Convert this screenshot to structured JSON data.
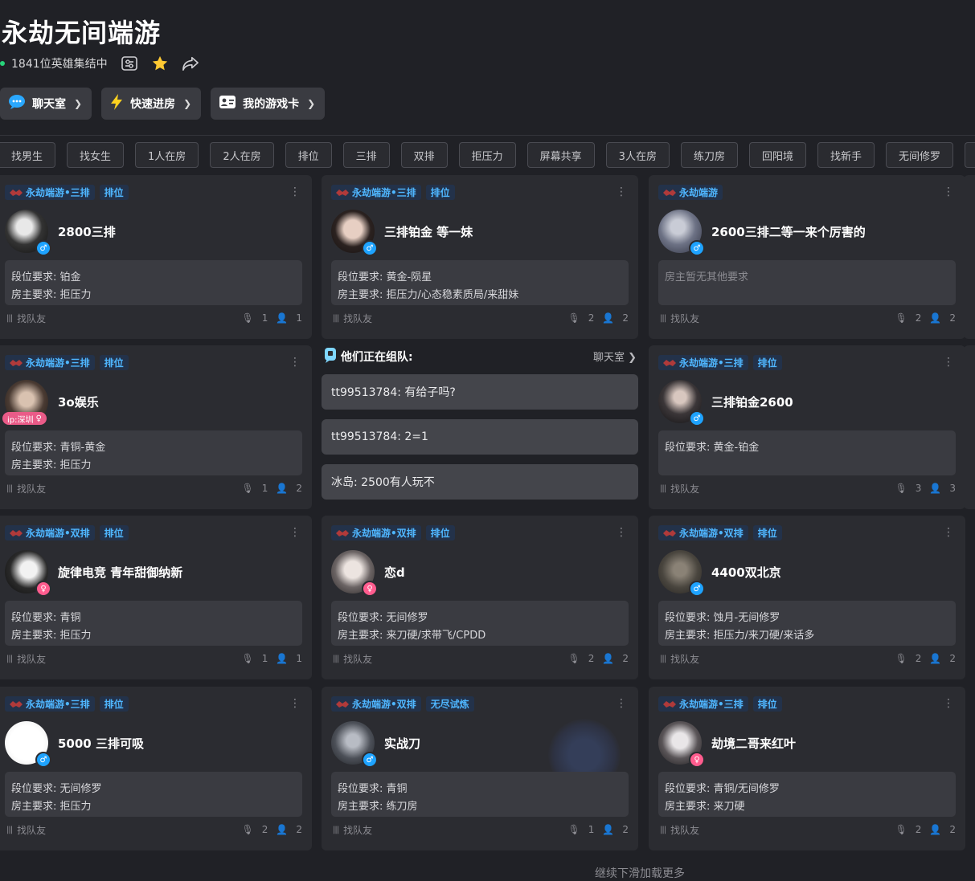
{
  "header": {
    "title": "永劫无间端游",
    "online_text": "1841位英雄集结中"
  },
  "buttons": [
    {
      "label": "聊天室",
      "icon": "chat-bubble-icon"
    },
    {
      "label": "快速进房",
      "icon": "lightning-icon"
    },
    {
      "label": "我的游戏卡",
      "icon": "id-card-icon"
    }
  ],
  "filters": [
    "找男生",
    "找女生",
    "1人在房",
    "2人在房",
    "排位",
    "三排",
    "双排",
    "拒压力",
    "屏幕共享",
    "3人在房",
    "练刀房",
    "回阳境",
    "找新手",
    "无间修罗"
  ],
  "colors": {
    "accent": "#4fb6ff",
    "male": "#1ea3ff",
    "female": "#ff5c8e",
    "online": "#27d47a"
  },
  "rooms": [
    {
      "game": "永劫端游•三排",
      "mode": "排位",
      "title": "2800三排",
      "gender": "male",
      "rank": "段位要求: 铂金",
      "owner": "房主要求: 拒压力",
      "footer": "找队友",
      "mic": "1",
      "people": "1"
    },
    {
      "game": "永劫端游•三排",
      "mode": "排位",
      "title": "三排铂金 等一妹",
      "gender": "male",
      "rank": "段位要求: 黄金-陨星",
      "owner": "房主要求: 拒压力/心态稳素质局/来甜妹",
      "footer": "找队友",
      "mic": "2",
      "people": "2"
    },
    {
      "game": "永劫端游",
      "mode": "",
      "title": "2600三排二等一来个厉害的",
      "gender": "male",
      "rank": "房主暂无其他要求",
      "owner": "",
      "footer": "找队友",
      "mic": "2",
      "people": "2"
    },
    {
      "game": "永劫端游•三排",
      "mode": "排位",
      "title": "3o娱乐",
      "gender": "female",
      "ip": "ip:深圳",
      "rank": "段位要求: 青铜-黄金",
      "owner": "房主要求: 拒压力",
      "footer": "找队友",
      "mic": "1",
      "people": "2"
    },
    {
      "game": "永劫端游•三排",
      "mode": "排位",
      "title": "三排铂金2600",
      "gender": "male",
      "rank": "段位要求: 黄金-铂金",
      "owner": "",
      "footer": "找队友",
      "mic": "3",
      "people": "3"
    },
    {
      "game": "永劫端游•双排",
      "mode": "排位",
      "title": "旋律电竞 青年甜御纳新",
      "gender": "female",
      "rank": "段位要求: 青铜",
      "owner": "房主要求: 拒压力",
      "footer": "找队友",
      "mic": "1",
      "people": "1"
    },
    {
      "game": "永劫端游•双排",
      "mode": "排位",
      "title": "恋d",
      "gender": "female",
      "rank": "段位要求: 无间修罗",
      "owner": "房主要求: 来刀硬/求带飞/CPDD",
      "footer": "找队友",
      "mic": "2",
      "people": "2"
    },
    {
      "game": "永劫端游•双排",
      "mode": "排位",
      "title": "4400双北京",
      "gender": "male",
      "rank": "段位要求: 蚀月-无间修罗",
      "owner": "房主要求: 拒压力/来刀硬/来话多",
      "footer": "找队友",
      "mic": "2",
      "people": "2"
    },
    {
      "game": "永劫端游•三排",
      "mode": "排位",
      "title": "5000 三排可吸",
      "gender": "male",
      "rank": "段位要求: 无间修罗",
      "owner": "房主要求: 拒压力",
      "footer": "找队友",
      "mic": "2",
      "people": "2"
    },
    {
      "game": "永劫端游•双排",
      "mode": "无尽试炼",
      "title": "实战刀",
      "gender": "male",
      "rank": "段位要求: 青铜",
      "owner": "房主要求: 练刀房",
      "footer": "找队友",
      "mic": "1",
      "people": "2"
    },
    {
      "game": "永劫端游•三排",
      "mode": "排位",
      "title": "劫境二哥来红叶",
      "gender": "female",
      "rank": "段位要求: 青铜/无间修罗",
      "owner": "房主要求: 来刀硬",
      "footer": "找队友",
      "mic": "2",
      "people": "2"
    }
  ],
  "chat": {
    "title": "他们正在组队:",
    "link": "聊天室",
    "messages": [
      "tt99513784: 有给子吗?",
      "tt99513784: 2=1",
      "冰岛: 2500有人玩不"
    ]
  },
  "load_more": "继续下滑加载更多"
}
